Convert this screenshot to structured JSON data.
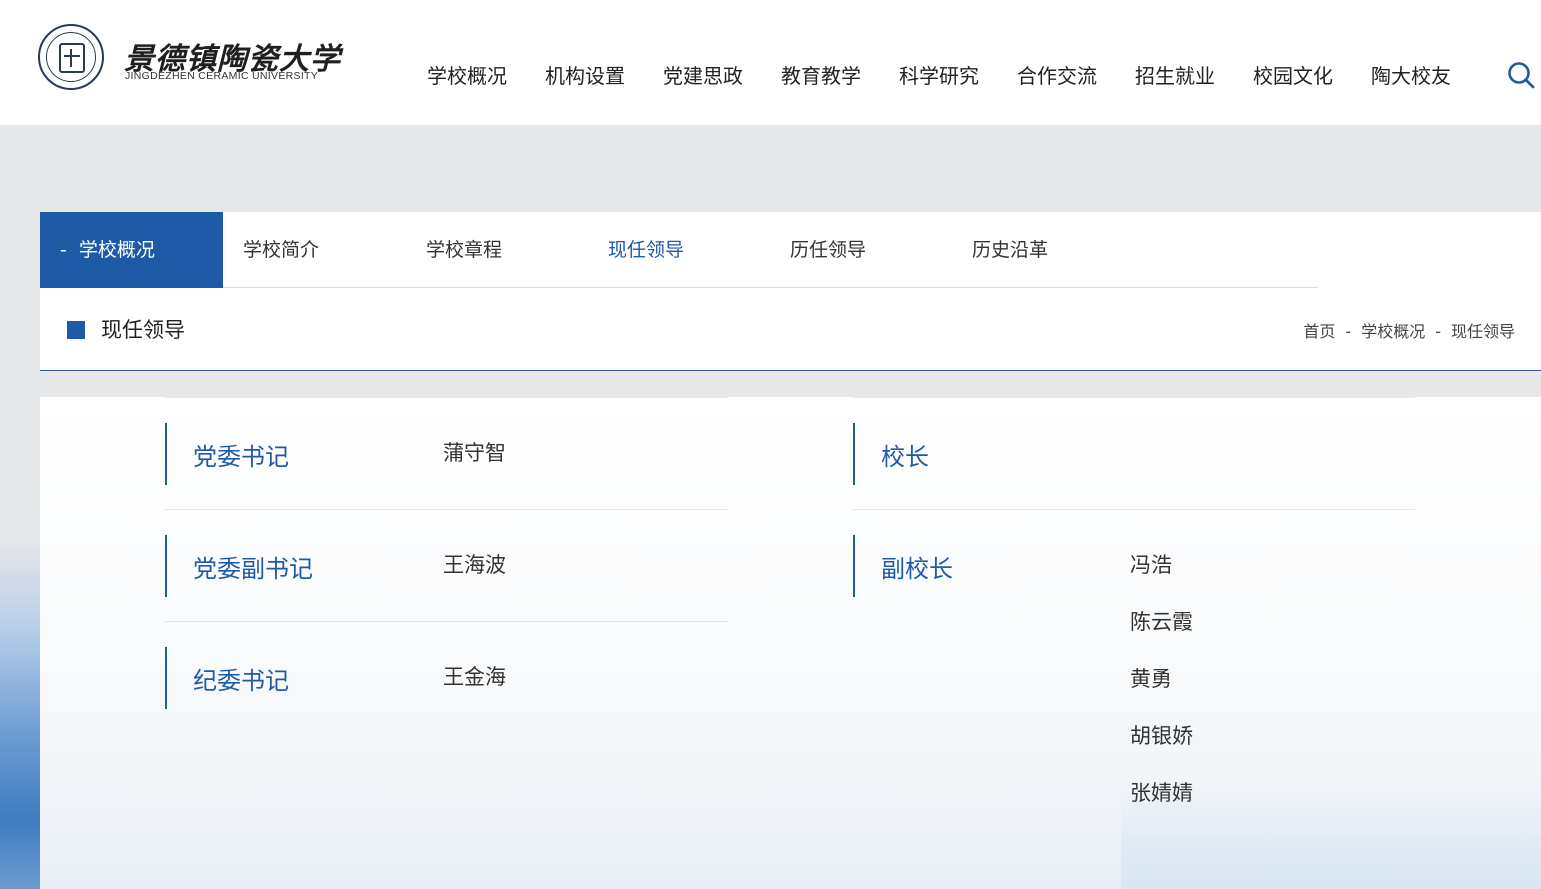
{
  "header": {
    "logo_cn": "景德镇陶瓷大学",
    "logo_en": "JINGDEZHEN CERAMIC UNIVERSITY",
    "nav": [
      "学校概况",
      "机构设置",
      "党建思政",
      "教育教学",
      "科学研究",
      "合作交流",
      "招生就业",
      "校园文化",
      "陶大校友"
    ],
    "search_icon": "search-icon",
    "accent_color": "#1f5aa6"
  },
  "subnav": {
    "current": "学校概况",
    "current_prefix": "-",
    "tabs": [
      "学校简介",
      "学校章程",
      "现任领导",
      "历任领导",
      "历史沿革"
    ],
    "active_tab": "现任领导"
  },
  "title_bar": {
    "title": "现任领导",
    "breadcrumb": [
      "首页",
      "学校概况",
      "现任领导"
    ],
    "separator": "-"
  },
  "leaders": {
    "left": [
      {
        "role": "党委书记",
        "names": [
          "蒲守智"
        ]
      },
      {
        "role": "党委副书记",
        "names": [
          "王海波"
        ]
      },
      {
        "role": "纪委书记",
        "names": [
          "王金海"
        ]
      }
    ],
    "right": [
      {
        "role": "校长",
        "names": []
      },
      {
        "role": "副校长",
        "names": [
          "冯浩",
          "陈云霞",
          "黄勇",
          "胡银娇",
          "张婧婧"
        ]
      }
    ]
  }
}
